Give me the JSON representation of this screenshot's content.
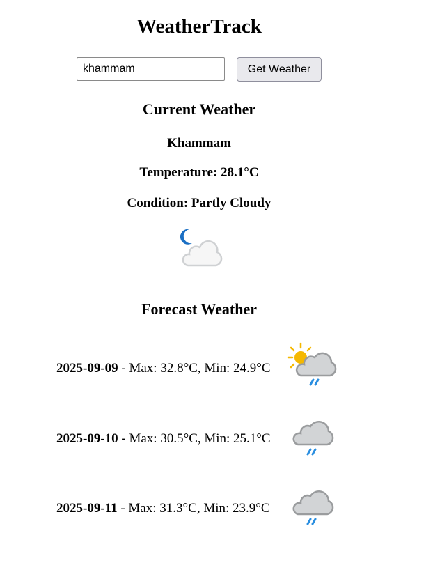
{
  "app": {
    "title": "WeatherTrack"
  },
  "search": {
    "value": "khammam",
    "button_label": "Get Weather"
  },
  "current": {
    "heading": "Current Weather",
    "city": "Khammam",
    "temperature_text": "Temperature: 28.1°C",
    "condition_text": "Condition: Partly Cloudy",
    "icon": "partly-cloudy-night-icon"
  },
  "forecast": {
    "heading": "Forecast Weather",
    "days": [
      {
        "date": "2025-09-09",
        "details": " - Max: 32.8°C, Min: 24.9°C",
        "icon": "sun-cloud-rain-icon"
      },
      {
        "date": "2025-09-10",
        "details": " - Max: 30.5°C, Min: 25.1°C",
        "icon": "cloud-rain-icon"
      },
      {
        "date": "2025-09-11",
        "details": " - Max: 31.3°C, Min: 23.9°C",
        "icon": "cloud-rain-icon"
      }
    ]
  },
  "colors": {
    "moon": "#1a6fc4",
    "sun": "#f5b800",
    "cloud_light": "#f2f2f2",
    "cloud_grey": "#d2d4d6",
    "rain": "#2a8ee0"
  }
}
